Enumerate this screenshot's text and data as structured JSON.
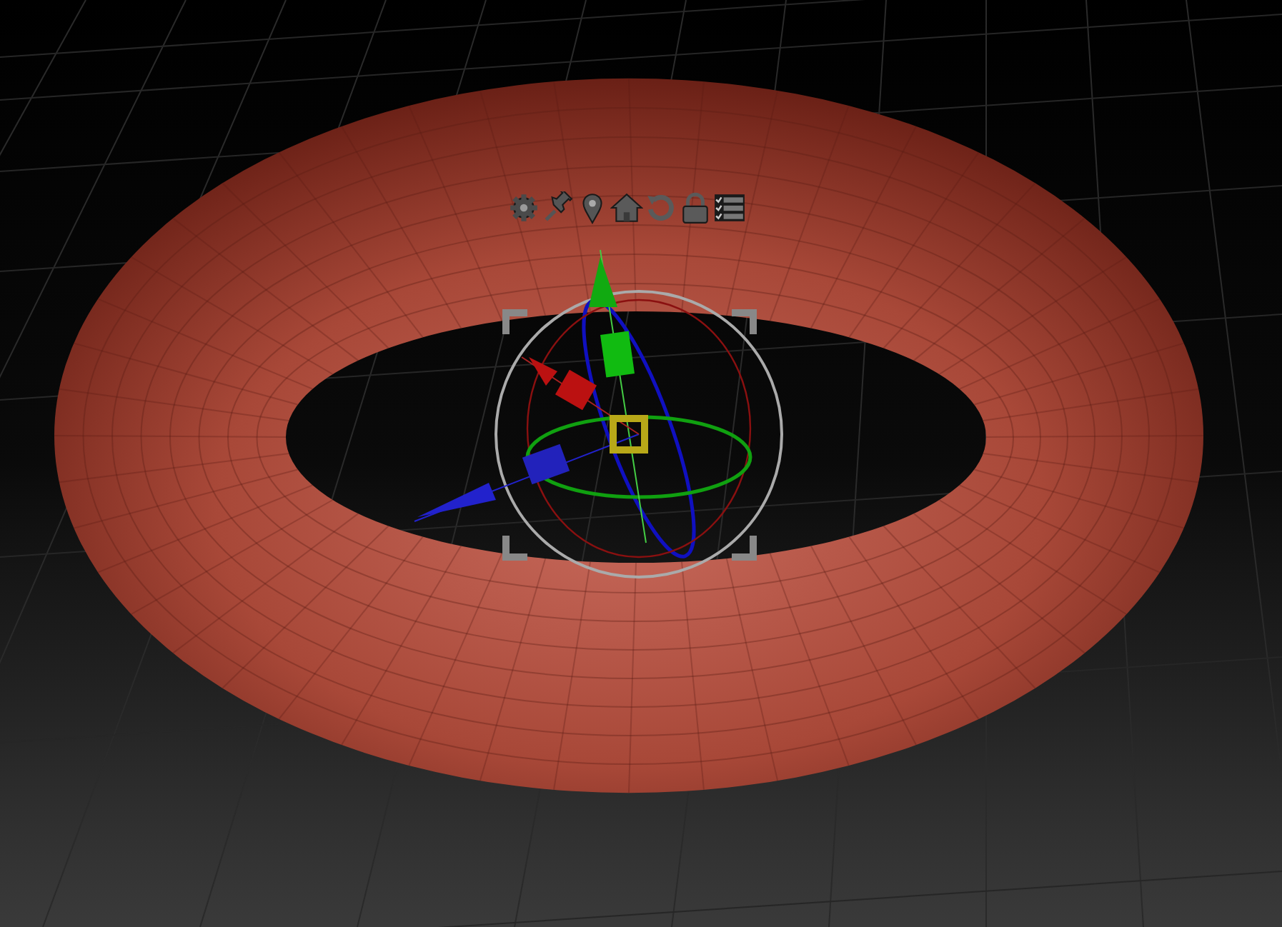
{
  "viewport": {
    "gizmo": {
      "visible": true
    },
    "gizmo_toolbar": [
      {
        "kind": "gear"
      },
      {
        "kind": "pin"
      },
      {
        "kind": "marker"
      },
      {
        "kind": "home"
      },
      {
        "kind": "reset"
      },
      {
        "kind": "lock"
      },
      {
        "kind": "checklist"
      }
    ]
  }
}
